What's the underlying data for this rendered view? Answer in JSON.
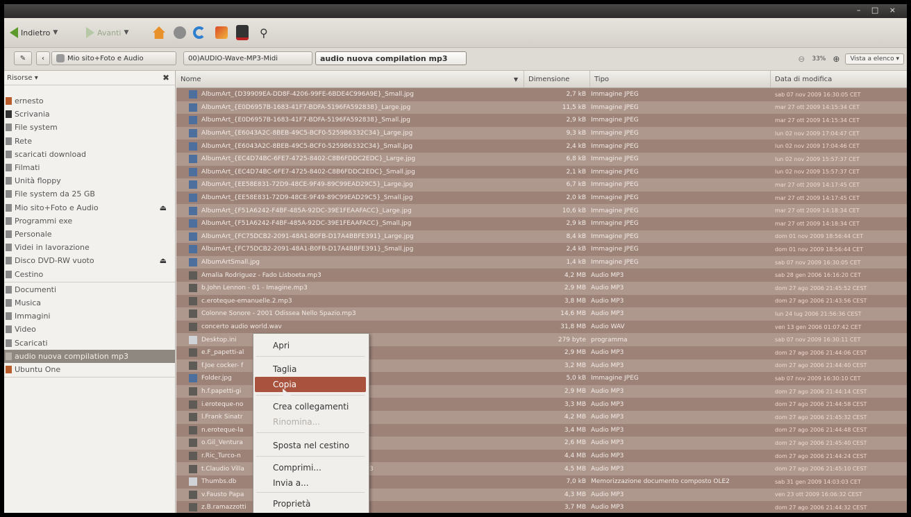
{
  "toolbar": {
    "back_label": "Indietro",
    "forward_label": "Avanti"
  },
  "window_controls": "– □ ×",
  "breadcrumbs": [
    "Mio sito+Foto e Audio",
    "00)AUDIO-Wave-MP3-Midi",
    "audio nuova compilation mp3"
  ],
  "zoom": {
    "level": "33%",
    "view": "Vista a elenco"
  },
  "sidebar": {
    "header": "Risorse",
    "items": [
      "ernesto",
      "Scrivania",
      "File system",
      "Rete",
      "scaricati download",
      "Filmati",
      "Unità floppy",
      "File system da 25 GB",
      "Mio sito+Foto e Audio",
      "Programmi exe",
      "Personale",
      "Videi in lavorazione",
      "Disco DVD-RW vuoto",
      "Cestino",
      "Documenti",
      "Musica",
      "Immagini",
      "Video",
      "Scaricati",
      "audio nuova compilation mp3",
      "Ubuntu One"
    ]
  },
  "columns": {
    "name": "Nome",
    "size": "Dimensione",
    "type": "Tipo",
    "date": "Data di modifica"
  },
  "files": [
    {
      "name": "AlbumArt_{D39909EA-DD8F-4206-99FE-6BDE4C996A9E}_Small.jpg",
      "size": "2,7 kB",
      "type": "Immagine JPEG",
      "date": "sab 07 nov 2009 16:30:05 CET"
    },
    {
      "name": "AlbumArt_{E0D6957B-1683-41F7-BDFA-5196FA592838}_Large.jpg",
      "size": "11,5 kB",
      "type": "Immagine JPEG",
      "date": "mar 27 ott 2009 14:15:34 CET"
    },
    {
      "name": "AlbumArt_{E0D6957B-1683-41F7-BDFA-5196FA592838}_Small.jpg",
      "size": "2,9 kB",
      "type": "Immagine JPEG",
      "date": "mar 27 ott 2009 14:15:34 CET"
    },
    {
      "name": "AlbumArt_{E6043A2C-8BEB-49C5-BCF0-5259B6332C34}_Large.jpg",
      "size": "9,3 kB",
      "type": "Immagine JPEG",
      "date": "lun 02 nov 2009 17:04:47 CET"
    },
    {
      "name": "AlbumArt_{E6043A2C-8BEB-49C5-BCF0-5259B6332C34}_Small.jpg",
      "size": "2,4 kB",
      "type": "Immagine JPEG",
      "date": "lun 02 nov 2009 17:04:46 CET"
    },
    {
      "name": "AlbumArt_{EC4D74BC-6FE7-4725-8402-C8B6FDDC2EDC}_Large.jpg",
      "size": "6,8 kB",
      "type": "Immagine JPEG",
      "date": "lun 02 nov 2009 15:57:37 CET"
    },
    {
      "name": "AlbumArt_{EC4D74BC-6FE7-4725-8402-C8B6FDDC2EDC}_Small.jpg",
      "size": "2,1 kB",
      "type": "Immagine JPEG",
      "date": "lun 02 nov 2009 15:57:37 CET"
    },
    {
      "name": "AlbumArt_{EE58E831-72D9-48CE-9F49-89C99EAD29C5}_Large.jpg",
      "size": "6,7 kB",
      "type": "Immagine JPEG",
      "date": "mar 27 ott 2009 14:17:45 CET"
    },
    {
      "name": "AlbumArt_{EE58E831-72D9-48CE-9F49-89C99EAD29C5}_Small.jpg",
      "size": "2,0 kB",
      "type": "Immagine JPEG",
      "date": "mar 27 ott 2009 14:17:45 CET"
    },
    {
      "name": "AlbumArt_{F51A6242-F4BF-485A-92DC-39E1FEAAFACC}_Large.jpg",
      "size": "10,6 kB",
      "type": "Immagine JPEG",
      "date": "mar 27 ott 2009 14:18:34 CET"
    },
    {
      "name": "AlbumArt_{F51A6242-F4BF-485A-92DC-39E1FEAAFACC}_Small.jpg",
      "size": "2,9 kB",
      "type": "Immagine JPEG",
      "date": "mar 27 ott 2009 14:18:34 CET"
    },
    {
      "name": "AlbumArt_{FC75DCB2-2091-48A1-B0FB-D17A4BBFE391}_Large.jpg",
      "size": "8,4 kB",
      "type": "Immagine JPEG",
      "date": "dom 01 nov 2009 18:56:44 CET"
    },
    {
      "name": "AlbumArt_{FC75DCB2-2091-48A1-B0FB-D17A4BBFE391}_Small.jpg",
      "size": "2,4 kB",
      "type": "Immagine JPEG",
      "date": "dom 01 nov 2009 18:56:44 CET"
    },
    {
      "name": "AlbumArtSmall.jpg",
      "size": "1,4 kB",
      "type": "Immagine JPEG",
      "date": "sab 07 nov 2009 16:30:05 CET"
    },
    {
      "name": "Amalia Rodriguez - Fado Lisboeta.mp3",
      "size": "4,2 MB",
      "type": "Audio MP3",
      "date": "sab 28 gen 2006 16:16:20 CET"
    },
    {
      "name": "b.John Lennon - 01 - Imagine.mp3",
      "size": "2,9 MB",
      "type": "Audio MP3",
      "date": "dom 27 ago 2006 21:45:52 CEST"
    },
    {
      "name": "c.eroteque-emanuelle.2.mp3",
      "size": "3,8 MB",
      "type": "Audio MP3",
      "date": "dom 27 ago 2006 21:43:56 CEST"
    },
    {
      "name": "Colonne Sonore - 2001 Odissea Nello Spazio.mp3",
      "size": "14,6 MB",
      "type": "Audio MP3",
      "date": "lun 24 lug 2006 21:56:36 CEST"
    },
    {
      "name": "concerto audio world.wav",
      "size": "31,8 MB",
      "type": "Audio WAV",
      "date": "ven 13 gen 2006 01:07:42 CET"
    },
    {
      "name": "Desktop.ini",
      "size": "279 byte",
      "type": "programma",
      "date": "sab 07 nov 2009 16:30:11 CET"
    },
    {
      "name": "e.F_papetti-al",
      "size": "2,9 MB",
      "type": "Audio MP3",
      "date": "dom 27 ago 2006 21:44:06 CEST"
    },
    {
      "name": "f.Joe cocker- f",
      "size": "3,2 MB",
      "type": "Audio MP3",
      "date": "dom 27 ago 2006 21:44:40 CEST"
    },
    {
      "name": "Folder.jpg",
      "size": "5,0 kB",
      "type": "Immagine JPEG",
      "date": "sab 07 nov 2009 16:30:10 CET"
    },
    {
      "name": "h.f.papetti-gi",
      "size": "2,9 MB",
      "type": "Audio MP3",
      "date": "dom 27 ago 2006 21:44:14 CEST"
    },
    {
      "name": "i.eroteque-no",
      "size": "3,3 MB",
      "type": "Audio MP3",
      "date": "dom 27 ago 2006 21:44:58 CEST"
    },
    {
      "name": "l.Frank Sinatr",
      "size": "4,2 MB",
      "type": "Audio MP3",
      "date": "dom 27 ago 2006 21:45:32 CEST"
    },
    {
      "name": "n.eroteque-la",
      "size": "3,4 MB",
      "type": "Audio MP3",
      "date": "dom 27 ago 2006 21:44:48 CEST"
    },
    {
      "name": "o.Gil_Ventura",
      "size": "2,6 MB",
      "type": "Audio MP3",
      "date": "dom 27 ago 2006 21:45:40 CEST"
    },
    {
      "name": "r.Ric_Turco-n",
      "size": "4,4 MB",
      "type": "Audio MP3",
      "date": "dom 27 ago 2006 21:44:24 CEST"
    },
    {
      "name": "t.Claudio Villa",
      "name_tail": "3",
      "size": "4,5 MB",
      "type": "Audio MP3",
      "date": "dom 27 ago 2006 21:45:10 CEST"
    },
    {
      "name": "Thumbs.db",
      "size": "7,0 kB",
      "type": "Memorizzazione documento composto OLE2",
      "date": "sab 31 gen 2009 14:03:03 CET"
    },
    {
      "name": "v.Fausto Papa",
      "size": "4,3 MB",
      "type": "Audio MP3",
      "date": "ven 23 ott 2009 16:06:32 CEST"
    },
    {
      "name": "z.B.ramazzotti",
      "size": "3,7 MB",
      "type": "Audio MP3",
      "date": "dom 27 ago 2006 21:44:32 CEST"
    }
  ],
  "context_menu": [
    "Apri",
    "Taglia",
    "Copia",
    "Crea collegamenti",
    "Rinomina...",
    "Sposta nel cestino",
    "Comprimi...",
    "Invia a...",
    "Proprietà"
  ]
}
